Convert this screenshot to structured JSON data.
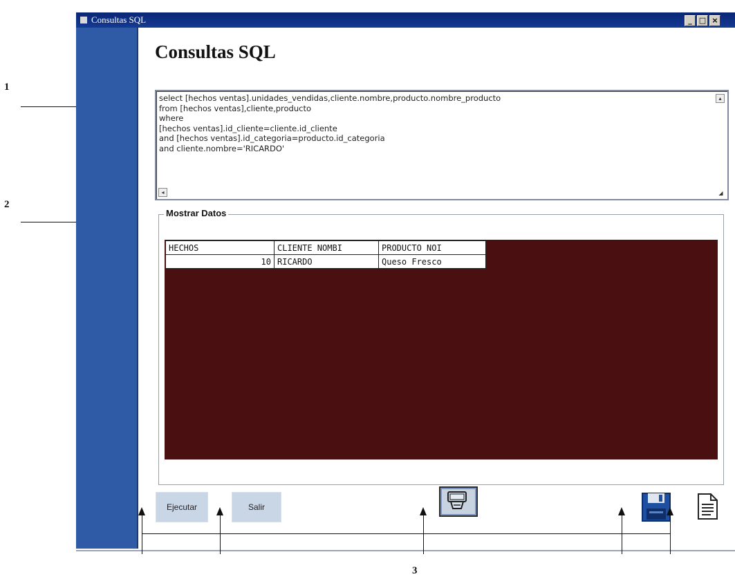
{
  "window": {
    "title": "Consultas SQL"
  },
  "page_title": "Consultas SQL",
  "query": {
    "text": "select [hechos ventas].unidades_vendidas,cliente.nombre,producto.nombre_producto\nfrom [hechos ventas],cliente,producto\nwhere\n[hechos ventas].id_cliente=cliente.id_cliente\nand [hechos ventas].id_categoria=producto.id_categoria\nand cliente.nombre='RICARDO'"
  },
  "results": {
    "group_label": "Mostrar Datos",
    "columns": [
      "HECHOS",
      "CLIENTE NOMBI",
      "PRODUCTO NOI"
    ],
    "rows": [
      [
        "10",
        "RICARDO",
        "Queso Fresco"
      ]
    ]
  },
  "buttons": {
    "ejecutar": "Ejecutar",
    "salir": "Salir"
  },
  "icons": {
    "print": "printer-icon",
    "save": "floppy-disk-icon",
    "document": "document-icon"
  },
  "annotations": [
    "1",
    "2",
    "3"
  ],
  "colors": {
    "titlebar": "#0c2a7a",
    "sidebar": "#2f5aa6",
    "grid_background": "#4a0f10",
    "button": "#c8d6e6"
  }
}
